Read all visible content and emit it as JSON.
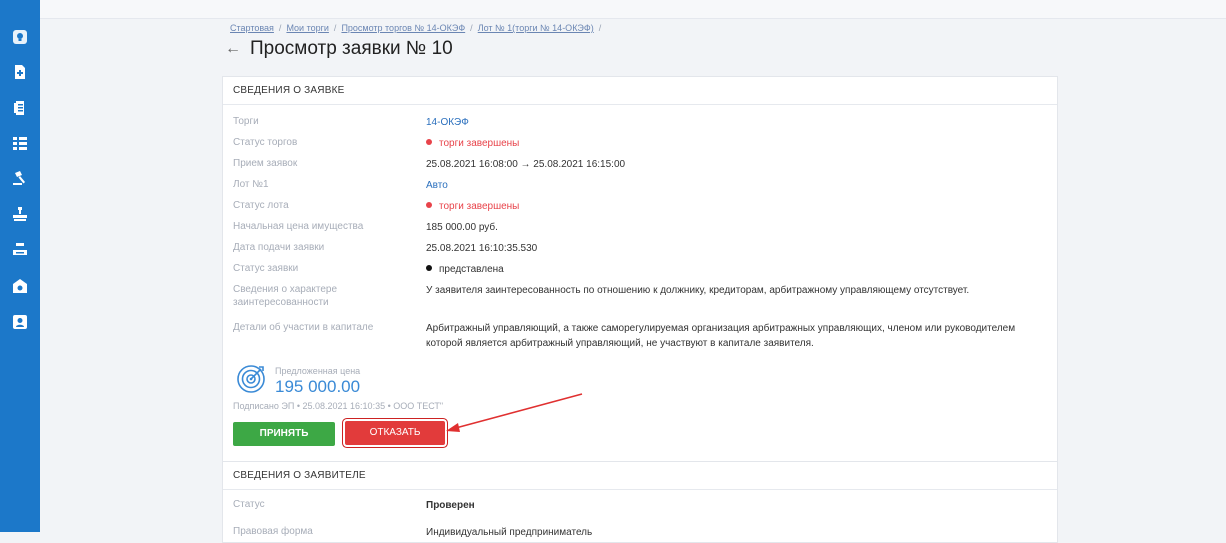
{
  "sidebar": {
    "icons": [
      "lightbulb-icon",
      "document-add-icon",
      "document-list-icon",
      "list-icon",
      "gavel-icon",
      "auction-icon",
      "auction-alt-icon",
      "building-icon",
      "profile-card-icon"
    ]
  },
  "breadcrumb": {
    "items": [
      "Стартовая",
      "Мои торги",
      "Просмотр торгов № 14-ОКЭФ",
      "Лот № 1(торги № 14-ОКЭФ)"
    ]
  },
  "page": {
    "title": "Просмотр заявки № 10",
    "back_icon": "arrow-left-icon"
  },
  "application": {
    "header": "СВЕДЕНИЯ О ЗАЯВКЕ",
    "rows": [
      {
        "label": "Торги",
        "value": "14-ОКЭФ"
      },
      {
        "label": "Статус торгов",
        "value": "торги завершены"
      },
      {
        "label": "Прием заявок",
        "value": "25.08.2021 16:08:00 → 25.08.2021 16:15:00"
      },
      {
        "label": "Лот №1",
        "value": "Авто"
      },
      {
        "label": "Статус лота",
        "value": "торги завершены"
      },
      {
        "label": "Начальная цена имущества",
        "value": "185 000.00 руб."
      },
      {
        "label": "Дата подачи заявки",
        "value": "25.08.2021 16:10:35.530"
      },
      {
        "label": "Статус заявки",
        "value": "представлена"
      },
      {
        "label": "Сведения о характере заинтересованности",
        "value": "У заявителя заинтересованность по отношению к должнику, кредиторам, арбитражному управляющему отсутствует."
      },
      {
        "label": "Детали об участии в капитале",
        "value": "Арбитражный управляющий, а также саморегулируемая организация арбитражных управляющих, членом или руководителем которой является арбитражный управляющий, не участвуют в капитале заявителя."
      }
    ],
    "price_label": "Предложенная цена",
    "price_value": "195 000.00",
    "signed": "Подписано ЭП  •  25.08.2021 16:10:35  •  ООО ТЕСТ\"",
    "accept_label": "ПРИНЯТЬ",
    "reject_label": "ОТКАЗАТЬ"
  },
  "applicant": {
    "header": "СВЕДЕНИЯ О ЗАЯВИТЕЛЕ",
    "rows": [
      {
        "label": "Статус",
        "value": "Проверен"
      },
      {
        "label": "Правовая форма",
        "value": "Индивидуальный предприниматель"
      }
    ]
  },
  "colors": {
    "sidebar": "#1c78c9",
    "accept": "#3da845",
    "reject": "#e23b3b",
    "status_red": "#e8434a",
    "link": "#2a6fbd",
    "price": "#3a8ad6"
  }
}
